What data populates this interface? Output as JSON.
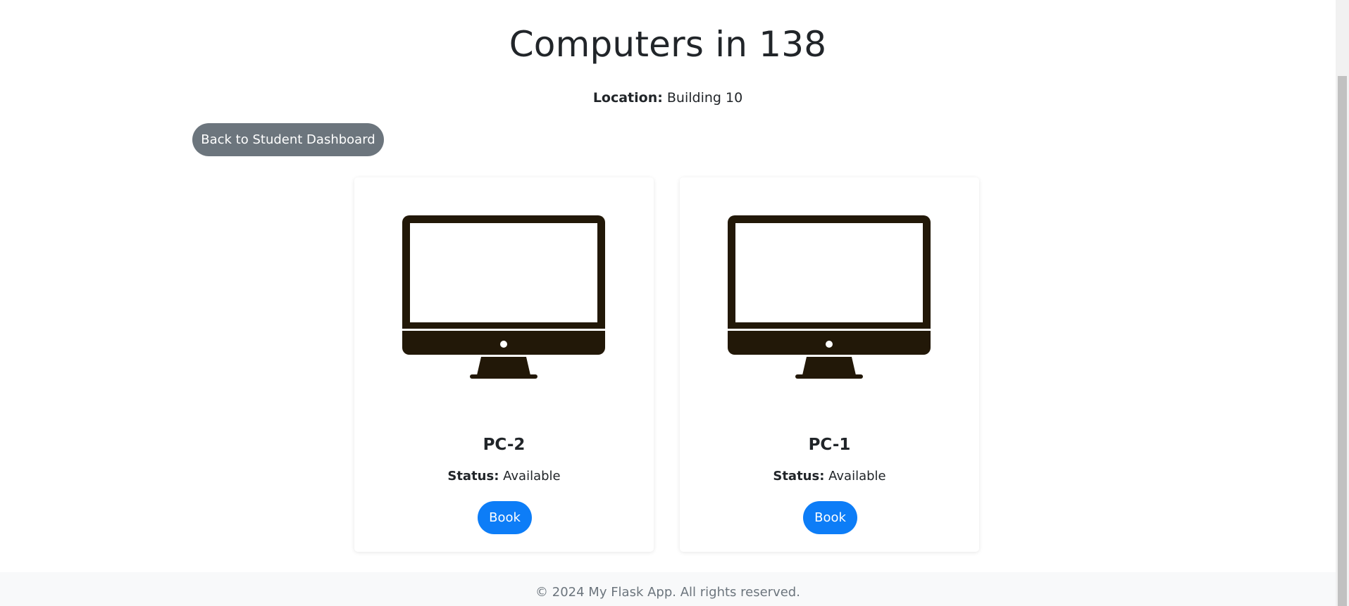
{
  "page": {
    "title": "Computers in 138",
    "location_label": "Location:",
    "location_value": "Building 10",
    "back_button": "Back to Student Dashboard"
  },
  "computers": [
    {
      "name": "PC-2",
      "status_label": "Status:",
      "status": "Available",
      "book_label": "Book",
      "icon": "monitor-icon"
    },
    {
      "name": "PC-1",
      "status_label": "Status:",
      "status": "Available",
      "book_label": "Book",
      "icon": "monitor-icon"
    }
  ],
  "footer": {
    "text": "© 2024 My Flask App. All rights reserved."
  },
  "colors": {
    "back_button": "#6c757d",
    "book_button": "#0d7df7",
    "monitor": "#221808",
    "footer_bg": "#f8f9fa"
  }
}
